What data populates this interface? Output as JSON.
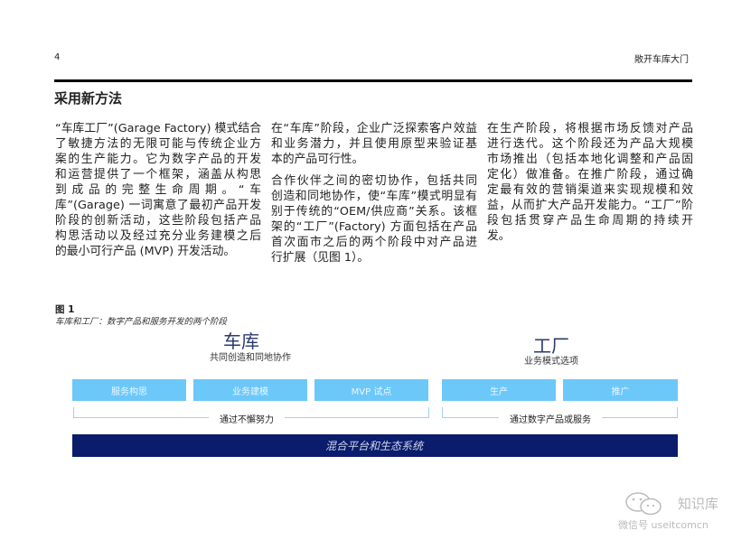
{
  "header": {
    "page_number": "4",
    "running_title": "敞开车库大门"
  },
  "section_title": "采用新方法",
  "columns": [
    {
      "paragraphs": [
        [
          "“车库工厂”(Garage Factory) 模式结合",
          "了敏捷方法的无限可能与传统企业方",
          "案的生产能力。它为数字产品的开发",
          "和运营提供了一个框架，涵盖从构思",
          "到成品的完整生命周期。“车",
          "库”(Garage) 一词寓意了最初产品开发",
          "阶段的创新活动，这些阶段包括产品",
          "构思活动以及经过充分业务建模之后",
          "的最小可行产品 (MVP) 开发活动。"
        ]
      ]
    },
    {
      "paragraphs": [
        [
          "在“车库”阶段，企业广泛探索客户效益",
          "和业务潜力，并且使用原型来验证基",
          "本的产品可行性。"
        ],
        [
          "合作伙伴之间的密切协作，包括共同",
          "创造和同地协作，使“车库”模式明显有",
          "别于传统的“OEM/供应商”关系。该框",
          "架的“工厂”(Factory) 方面包括在产品",
          "首次面市之后的两个阶段中对产品进",
          "行扩展（见图 1）。"
        ]
      ]
    },
    {
      "paragraphs": [
        [
          "在生产阶段，将根据市场反馈对产品",
          "进行迭代。这个阶段还为产品大规模",
          "市场推出（包括本地化调整和产品固",
          "定化）做准备。在推广阶段，通过确",
          "定最有效的营销渠道来实现规模和效",
          "益，从而扩大产品开发能力。“工厂”阶",
          "段包括贯穿产品生命周期的持续开",
          "发。"
        ]
      ]
    }
  ],
  "figure": {
    "number": "图 1",
    "caption": "车库和工厂：数字产品和服务开发的两个阶段",
    "garage": {
      "title": "车库",
      "subtitle": "共同创造和同地协作",
      "steps": [
        "服务构思",
        "业务建模",
        "MVP 试点"
      ],
      "bracket_label": "通过不懈努力"
    },
    "factory": {
      "title": "工厂",
      "subtitle": "业务模式选项",
      "steps": [
        "生产",
        "推广"
      ],
      "bracket_label": "通过数字产品或服务"
    },
    "platform": "混合平台和生态系统",
    "colors": {
      "step": "#6cc8f9",
      "platform": "#0b1c6c"
    }
  },
  "watermark": {
    "name": "知识库",
    "id": "微信号 useitcomcn"
  }
}
